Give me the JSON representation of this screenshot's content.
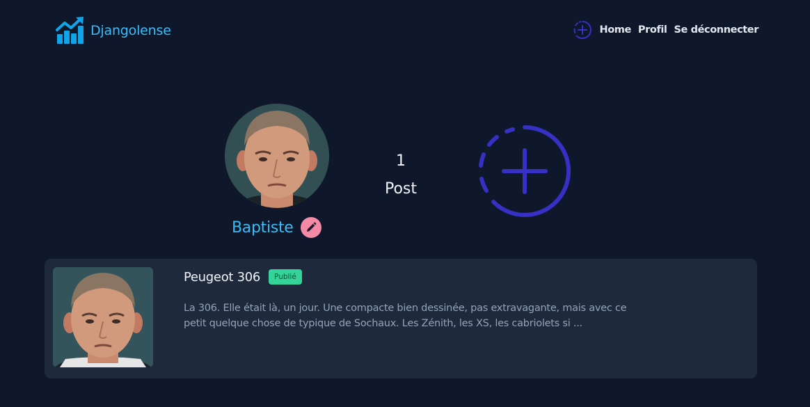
{
  "header": {
    "brand_name": "Djangolense",
    "nav": {
      "home_label": "Home",
      "profile_label": "Profil",
      "logout_label": "Se déconnecter"
    }
  },
  "profile": {
    "username": "Baptiste",
    "post_count": "1",
    "post_count_label": "Post"
  },
  "posts": [
    {
      "title": "Peugeot 306",
      "status": "Publié",
      "excerpt": "La 306. Elle était là, un jour. Une compacte bien dessinée, pas extravagante, mais avec ce petit quelque chose de typique de Sochaux. Les Zénith, les XS, les cabriolets si ..."
    }
  ],
  "colors": {
    "background": "#0f172a",
    "card": "#1e293b",
    "accent": "#38bdf8",
    "add_icon": "#3730c4",
    "edit_button": "#f58aa6",
    "badge": "#34d399"
  },
  "icons": {
    "brand": "chart-growth-icon",
    "nav_add": "add-circle-dashed-icon",
    "edit": "pencil-icon",
    "add_big": "add-circle-dashed-icon"
  }
}
